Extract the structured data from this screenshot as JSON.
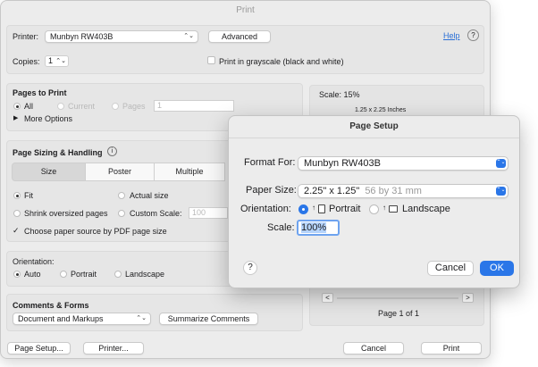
{
  "window": {
    "title": "Print"
  },
  "printer_row": {
    "printer_label": "Printer:",
    "printer_value": "Munbyn RW403B",
    "advanced_label": "Advanced",
    "help_label": "Help",
    "copies_label": "Copies:",
    "copies_value": "1",
    "grayscale_label": "Print in grayscale (black and white)"
  },
  "pages_to_print": {
    "heading": "Pages to Print",
    "all_label": "All",
    "current_label": "Current",
    "pages_label": "Pages",
    "pages_value": "1",
    "more_options_label": "More Options"
  },
  "sizing": {
    "heading": "Page Sizing & Handling",
    "tabs": [
      "Size",
      "Poster",
      "Multiple"
    ],
    "fit_label": "Fit",
    "actual_size_label": "Actual size",
    "shrink_label": "Shrink oversized pages",
    "custom_scale_label": "Custom Scale:",
    "custom_scale_value": "100",
    "paper_source_label": "Choose paper source by PDF page size"
  },
  "orientation": {
    "heading": "Orientation:",
    "auto_label": "Auto",
    "portrait_label": "Portrait",
    "landscape_label": "Landscape"
  },
  "comments": {
    "heading": "Comments & Forms",
    "select_value": "Document and Markups",
    "summarize_label": "Summarize Comments"
  },
  "preview": {
    "scale_label": "Scale: 15%",
    "size_label": "1.25 x 2.25 Inches",
    "prev_label": "<",
    "next_label": ">",
    "page_label": "Page 1 of 1"
  },
  "footer": {
    "page_setup_label": "Page Setup...",
    "printer_label": "Printer...",
    "cancel_label": "Cancel",
    "print_label": "Print"
  },
  "page_setup_sheet": {
    "title": "Page Setup",
    "format_for_label": "Format For:",
    "format_for_value": "Munbyn RW403B",
    "paper_size_label": "Paper Size:",
    "paper_size_value": "2.25\" x 1.25\"",
    "paper_size_detail": "56 by 31 mm",
    "orientation_label": "Orientation:",
    "portrait_label": "Portrait",
    "landscape_label": "Landscape",
    "scale_label": "Scale:",
    "scale_value": "100%",
    "help_label": "?",
    "cancel_label": "Cancel",
    "ok_label": "OK"
  },
  "colors": {
    "accent": "#2a76e8",
    "help_link": "#2a6fd6"
  },
  "icons": {
    "info": "info-icon",
    "help": "help-icon",
    "disclosure": "disclosure-triangle-icon"
  }
}
